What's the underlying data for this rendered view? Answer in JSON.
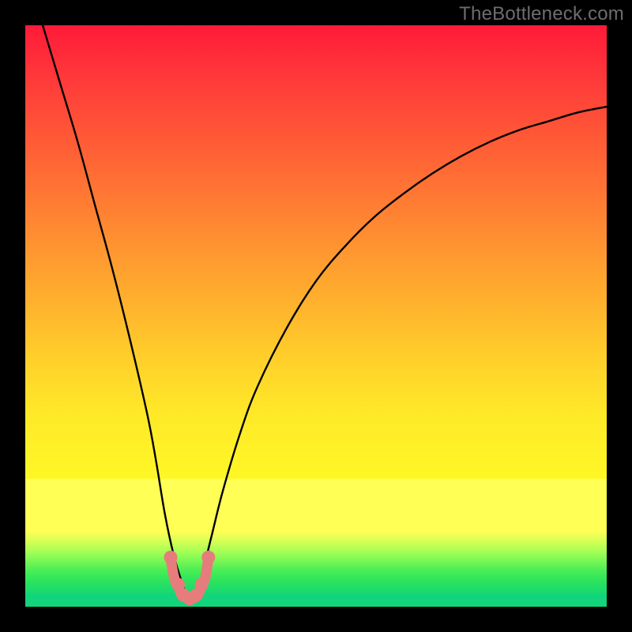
{
  "watermark": "TheBottleneck.com",
  "colors": {
    "frame": "#000000",
    "gradient_top": "#ff1a38",
    "gradient_mid": "#ffd22a",
    "gradient_yellow": "#ffff55",
    "gradient_green": "#12d47a",
    "curve": "#000000",
    "marker_fill": "#e77c7c",
    "marker_stroke": "#d96a6a"
  },
  "chart_data": {
    "type": "line",
    "title": "",
    "xlabel": "",
    "ylabel": "",
    "xlim": [
      0,
      100
    ],
    "ylim": [
      0,
      100
    ],
    "series": [
      {
        "name": "bottleneck-curve",
        "x": [
          3,
          6,
          9,
          12,
          15,
          18,
          21,
          22.5,
          24,
          25.5,
          27,
          28,
          29,
          30,
          32,
          34,
          37,
          40,
          45,
          50,
          55,
          60,
          65,
          70,
          75,
          80,
          85,
          90,
          95,
          100
        ],
        "y": [
          100,
          90,
          80,
          69,
          58,
          46,
          33,
          25,
          16,
          9,
          4,
          1.5,
          1.5,
          4,
          12,
          20,
          30,
          38,
          48,
          56,
          62,
          67,
          71,
          74.5,
          77.5,
          80,
          82,
          83.5,
          85,
          86
        ]
      }
    ],
    "minimum_markers": {
      "x": [
        25.0,
        26.3,
        27.2,
        28.3,
        29.4,
        30.3,
        31.5
      ],
      "y": [
        8.5,
        3.8,
        2.0,
        1.4,
        2.0,
        3.8,
        8.5
      ]
    }
  }
}
